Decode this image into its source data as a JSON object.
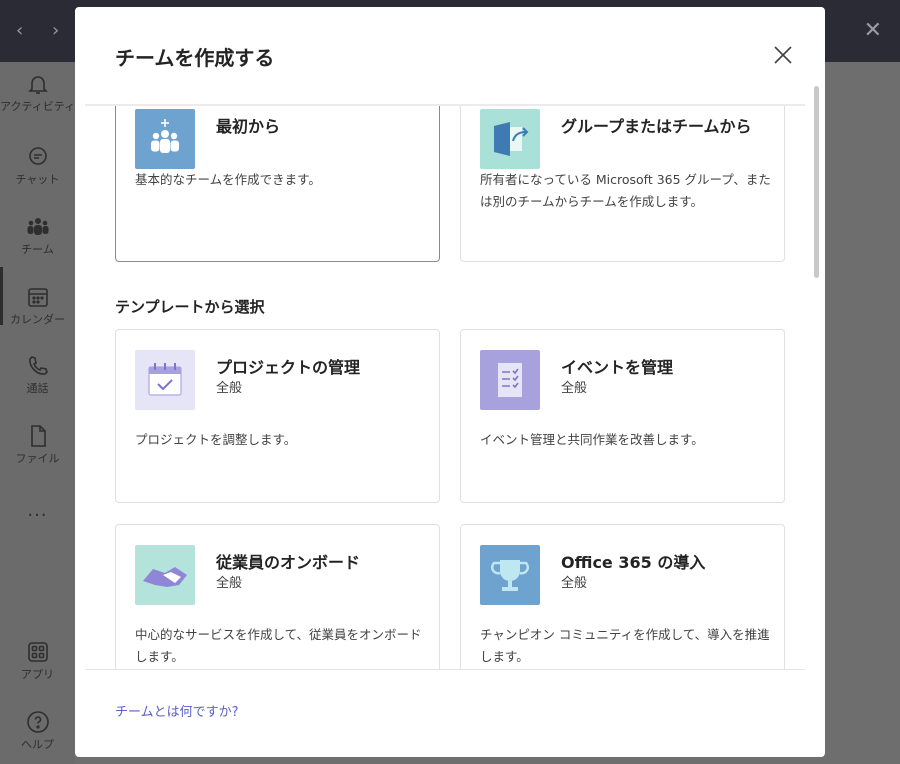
{
  "app": {
    "rail": [
      {
        "label": "アクティビティ",
        "icon": "bell-icon"
      },
      {
        "label": "チャット",
        "icon": "chat-icon"
      },
      {
        "label": "チーム",
        "icon": "teams-icon"
      },
      {
        "label": "カレンダー",
        "icon": "calendar-icon"
      },
      {
        "label": "通話",
        "icon": "phone-icon"
      },
      {
        "label": "ファイル",
        "icon": "file-icon"
      },
      {
        "label": "アプリ",
        "icon": "apps-icon"
      },
      {
        "label": "ヘルプ",
        "icon": "help-icon"
      }
    ],
    "more": "..."
  },
  "dialog": {
    "title": "チームを作成する",
    "create_options": [
      {
        "title": "最初から",
        "description": "基本的なチームを作成できます。",
        "icon": "people-plus-icon",
        "color": "#6fa3cf"
      },
      {
        "title": "グループまたはチームから",
        "description": "所有者になっている Microsoft 365 グループ、または別のチームからチームを作成します。",
        "icon": "group-arrow-icon",
        "color": "#a9e0d8"
      }
    ],
    "templates_heading": "テンプレートから選択",
    "templates": [
      {
        "title": "プロジェクトの管理",
        "subtitle": "全般",
        "description": "プロジェクトを調整します。",
        "icon": "calendar-check-icon",
        "color": "#e6e4f7"
      },
      {
        "title": "イベントを管理",
        "subtitle": "全般",
        "description": "イベント管理と共同作業を改善します。",
        "icon": "checklist-icon",
        "color": "#a7a2de"
      },
      {
        "title": "従業員のオンボード",
        "subtitle": "全般",
        "description": "中心的なサービスを作成して、従業員をオンボードします。",
        "icon": "handshake-icon",
        "color": "#b3e3db"
      },
      {
        "title": "Office 365 の導入",
        "subtitle": "全般",
        "description": "チャンピオン コミュニティを作成して、導入を推進します。",
        "icon": "trophy-icon",
        "color": "#6fa3cf"
      }
    ],
    "footer_link": "チームとは何ですか?"
  }
}
